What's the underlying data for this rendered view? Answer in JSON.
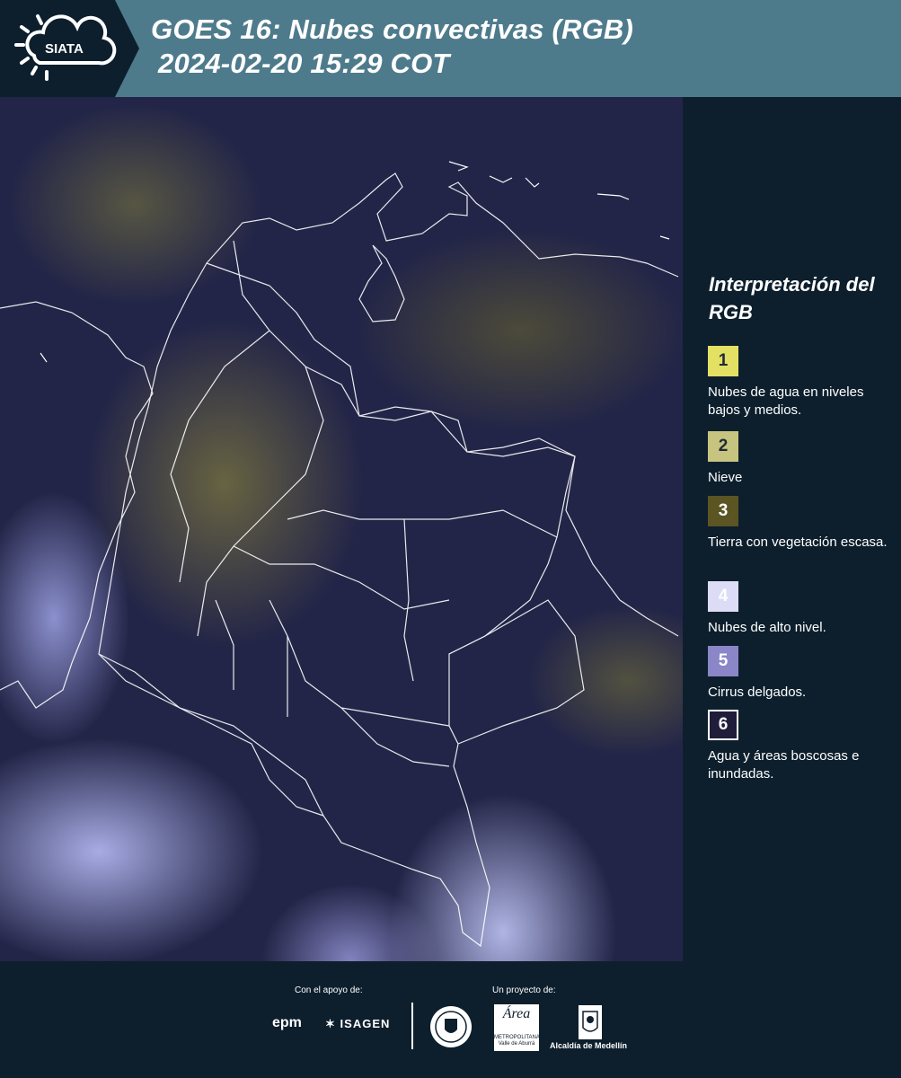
{
  "header": {
    "logo_text": "SIATA",
    "title_line1": "GOES 16: Nubes convectivas (RGB)",
    "title_line2": "2024-02-20 15:29 COT"
  },
  "map": {
    "description_icon": "satellite-map-image"
  },
  "legend": {
    "title": "Interpretación del RGB",
    "items": [
      {
        "number": "1",
        "label": "Nubes de agua en niveles bajos y medios.",
        "color": "#e3e063"
      },
      {
        "number": "2",
        "label": "Nieve",
        "color": "#c7c47f"
      },
      {
        "number": "3",
        "label": "Tierra con vegetación escasa.",
        "color": "#5a5523"
      },
      {
        "number": "4",
        "label": "Nubes de alto nivel.",
        "color": "#dcdcf6"
      },
      {
        "number": "5",
        "label": "Cirrus delgados.",
        "color": "#8a86c8"
      },
      {
        "number": "6",
        "label": "Agua y áreas boscosas e inundadas.",
        "color": "#1f1d3a"
      }
    ]
  },
  "footer": {
    "support_label": "Con el apoyo de:",
    "project_label": "Un proyecto de:",
    "epm_logo": "epm",
    "isagen_logo": "ISAGEN",
    "metro_logo_name": "Área",
    "metro_logo_sub": "METROPOLITANA Valle de Aburrá",
    "alcaldia_label": "Alcaldía de Medellín"
  }
}
